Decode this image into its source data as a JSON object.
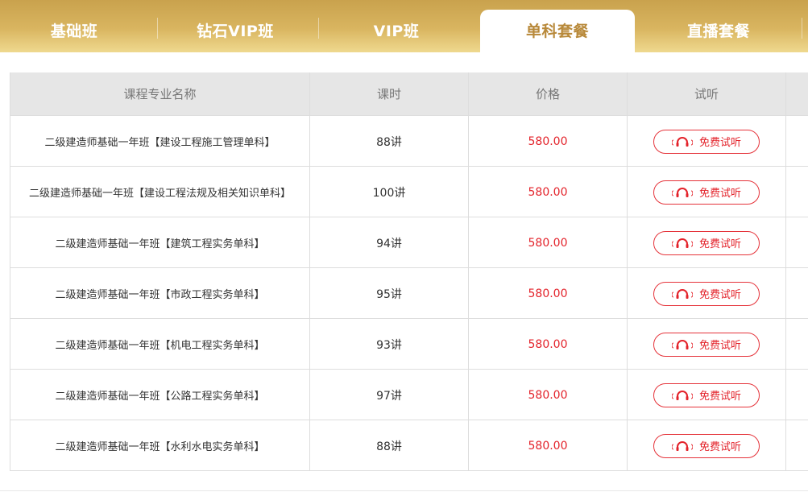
{
  "tabs": [
    {
      "label": "基础班"
    },
    {
      "label": "钻石VIP班"
    },
    {
      "label": "VIP班"
    },
    {
      "label": "单科套餐",
      "active": true
    },
    {
      "label": "直播套餐"
    }
  ],
  "table": {
    "headers": [
      "课程专业名称",
      "课时",
      "价格",
      "试听"
    ],
    "rows": [
      {
        "name": "二级建造师基础一年班【建设工程施工管理单科】",
        "hours": "88讲",
        "price": "580.00",
        "trial": "免费试听"
      },
      {
        "name": "二级建造师基础一年班【建设工程法规及相关知识单科】",
        "hours": "100讲",
        "price": "580.00",
        "trial": "免费试听"
      },
      {
        "name": "二级建造师基础一年班【建筑工程实务单科】",
        "hours": "94讲",
        "price": "580.00",
        "trial": "免费试听"
      },
      {
        "name": "二级建造师基础一年班【市政工程实务单科】",
        "hours": "95讲",
        "price": "580.00",
        "trial": "免费试听"
      },
      {
        "name": "二级建造师基础一年班【机电工程实务单科】",
        "hours": "93讲",
        "price": "580.00",
        "trial": "免费试听"
      },
      {
        "name": "二级建造师基础一年班【公路工程实务单科】",
        "hours": "97讲",
        "price": "580.00",
        "trial": "免费试听"
      },
      {
        "name": "二级建造师基础一年班【水利水电实务单科】",
        "hours": "88讲",
        "price": "580.00",
        "trial": "免费试听"
      }
    ]
  },
  "colors": {
    "accent_gold": "#c9a24d",
    "active_tab_text": "#b8893a",
    "price_red": "#e3222a"
  },
  "icons": {
    "trial": "headphones-icon"
  }
}
